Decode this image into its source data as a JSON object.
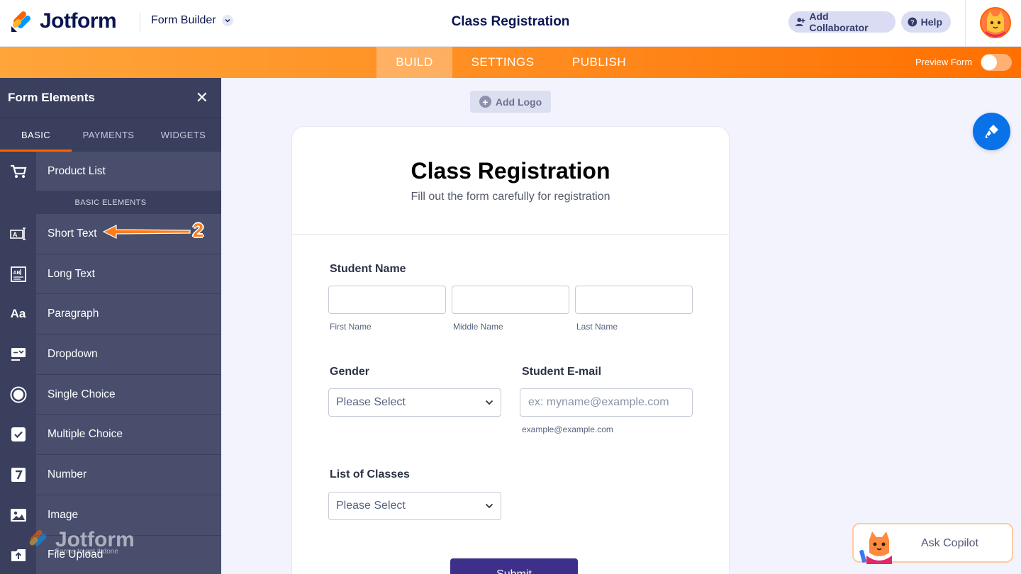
{
  "header": {
    "brand": "Jotform",
    "builder_label": "Form Builder",
    "form_title": "Class Registration",
    "add_collaborator": "Add Collaborator",
    "help": "Help"
  },
  "nav": {
    "tabs": [
      {
        "label": "BUILD",
        "active": true
      },
      {
        "label": "SETTINGS",
        "active": false
      },
      {
        "label": "PUBLISH",
        "active": false
      }
    ],
    "preview_label": "Preview Form",
    "preview_on": false
  },
  "sidebar": {
    "title": "Form Elements",
    "tabs": [
      "BASIC",
      "PAYMENTS",
      "WIDGETS"
    ],
    "product_item": "Product List",
    "section_label": "BASIC ELEMENTS",
    "items": [
      {
        "label": "Short Text",
        "icon": "short-text-icon"
      },
      {
        "label": "Long Text",
        "icon": "long-text-icon"
      },
      {
        "label": "Paragraph",
        "icon": "paragraph-icon"
      },
      {
        "label": "Dropdown",
        "icon": "dropdown-icon"
      },
      {
        "label": "Single Choice",
        "icon": "single-choice-icon"
      },
      {
        "label": "Multiple Choice",
        "icon": "multiple-choice-icon"
      },
      {
        "label": "Number",
        "icon": "number-icon"
      },
      {
        "label": "Image",
        "icon": "image-icon"
      },
      {
        "label": "File Upload",
        "icon": "file-upload-icon"
      }
    ],
    "annotation_number": "2",
    "watermark_brand": "Jotform",
    "watermark_tagline": "Forms to get it done"
  },
  "canvas": {
    "add_logo": "Add Logo",
    "form": {
      "title": "Class Registration",
      "subtitle": "Fill out the form carefully for registration",
      "student_name_label": "Student Name",
      "first_name": "First Name",
      "middle_name": "Middle Name",
      "last_name": "Last Name",
      "gender_label": "Gender",
      "gender_placeholder": "Please Select",
      "email_label": "Student E-mail",
      "email_placeholder": "ex: myname@example.com",
      "email_sublabel": "example@example.com",
      "classes_label": "List of Classes",
      "classes_placeholder": "Please Select",
      "submit": "Submit"
    }
  },
  "copilot": {
    "label": "Ask Copilot"
  },
  "colors": {
    "brand_orange": "#ff6100",
    "navy": "#0a1551",
    "sidebar_bg": "#484e6c",
    "submit_bg": "#3e2f8a",
    "fab_blue": "#0a72e8"
  }
}
